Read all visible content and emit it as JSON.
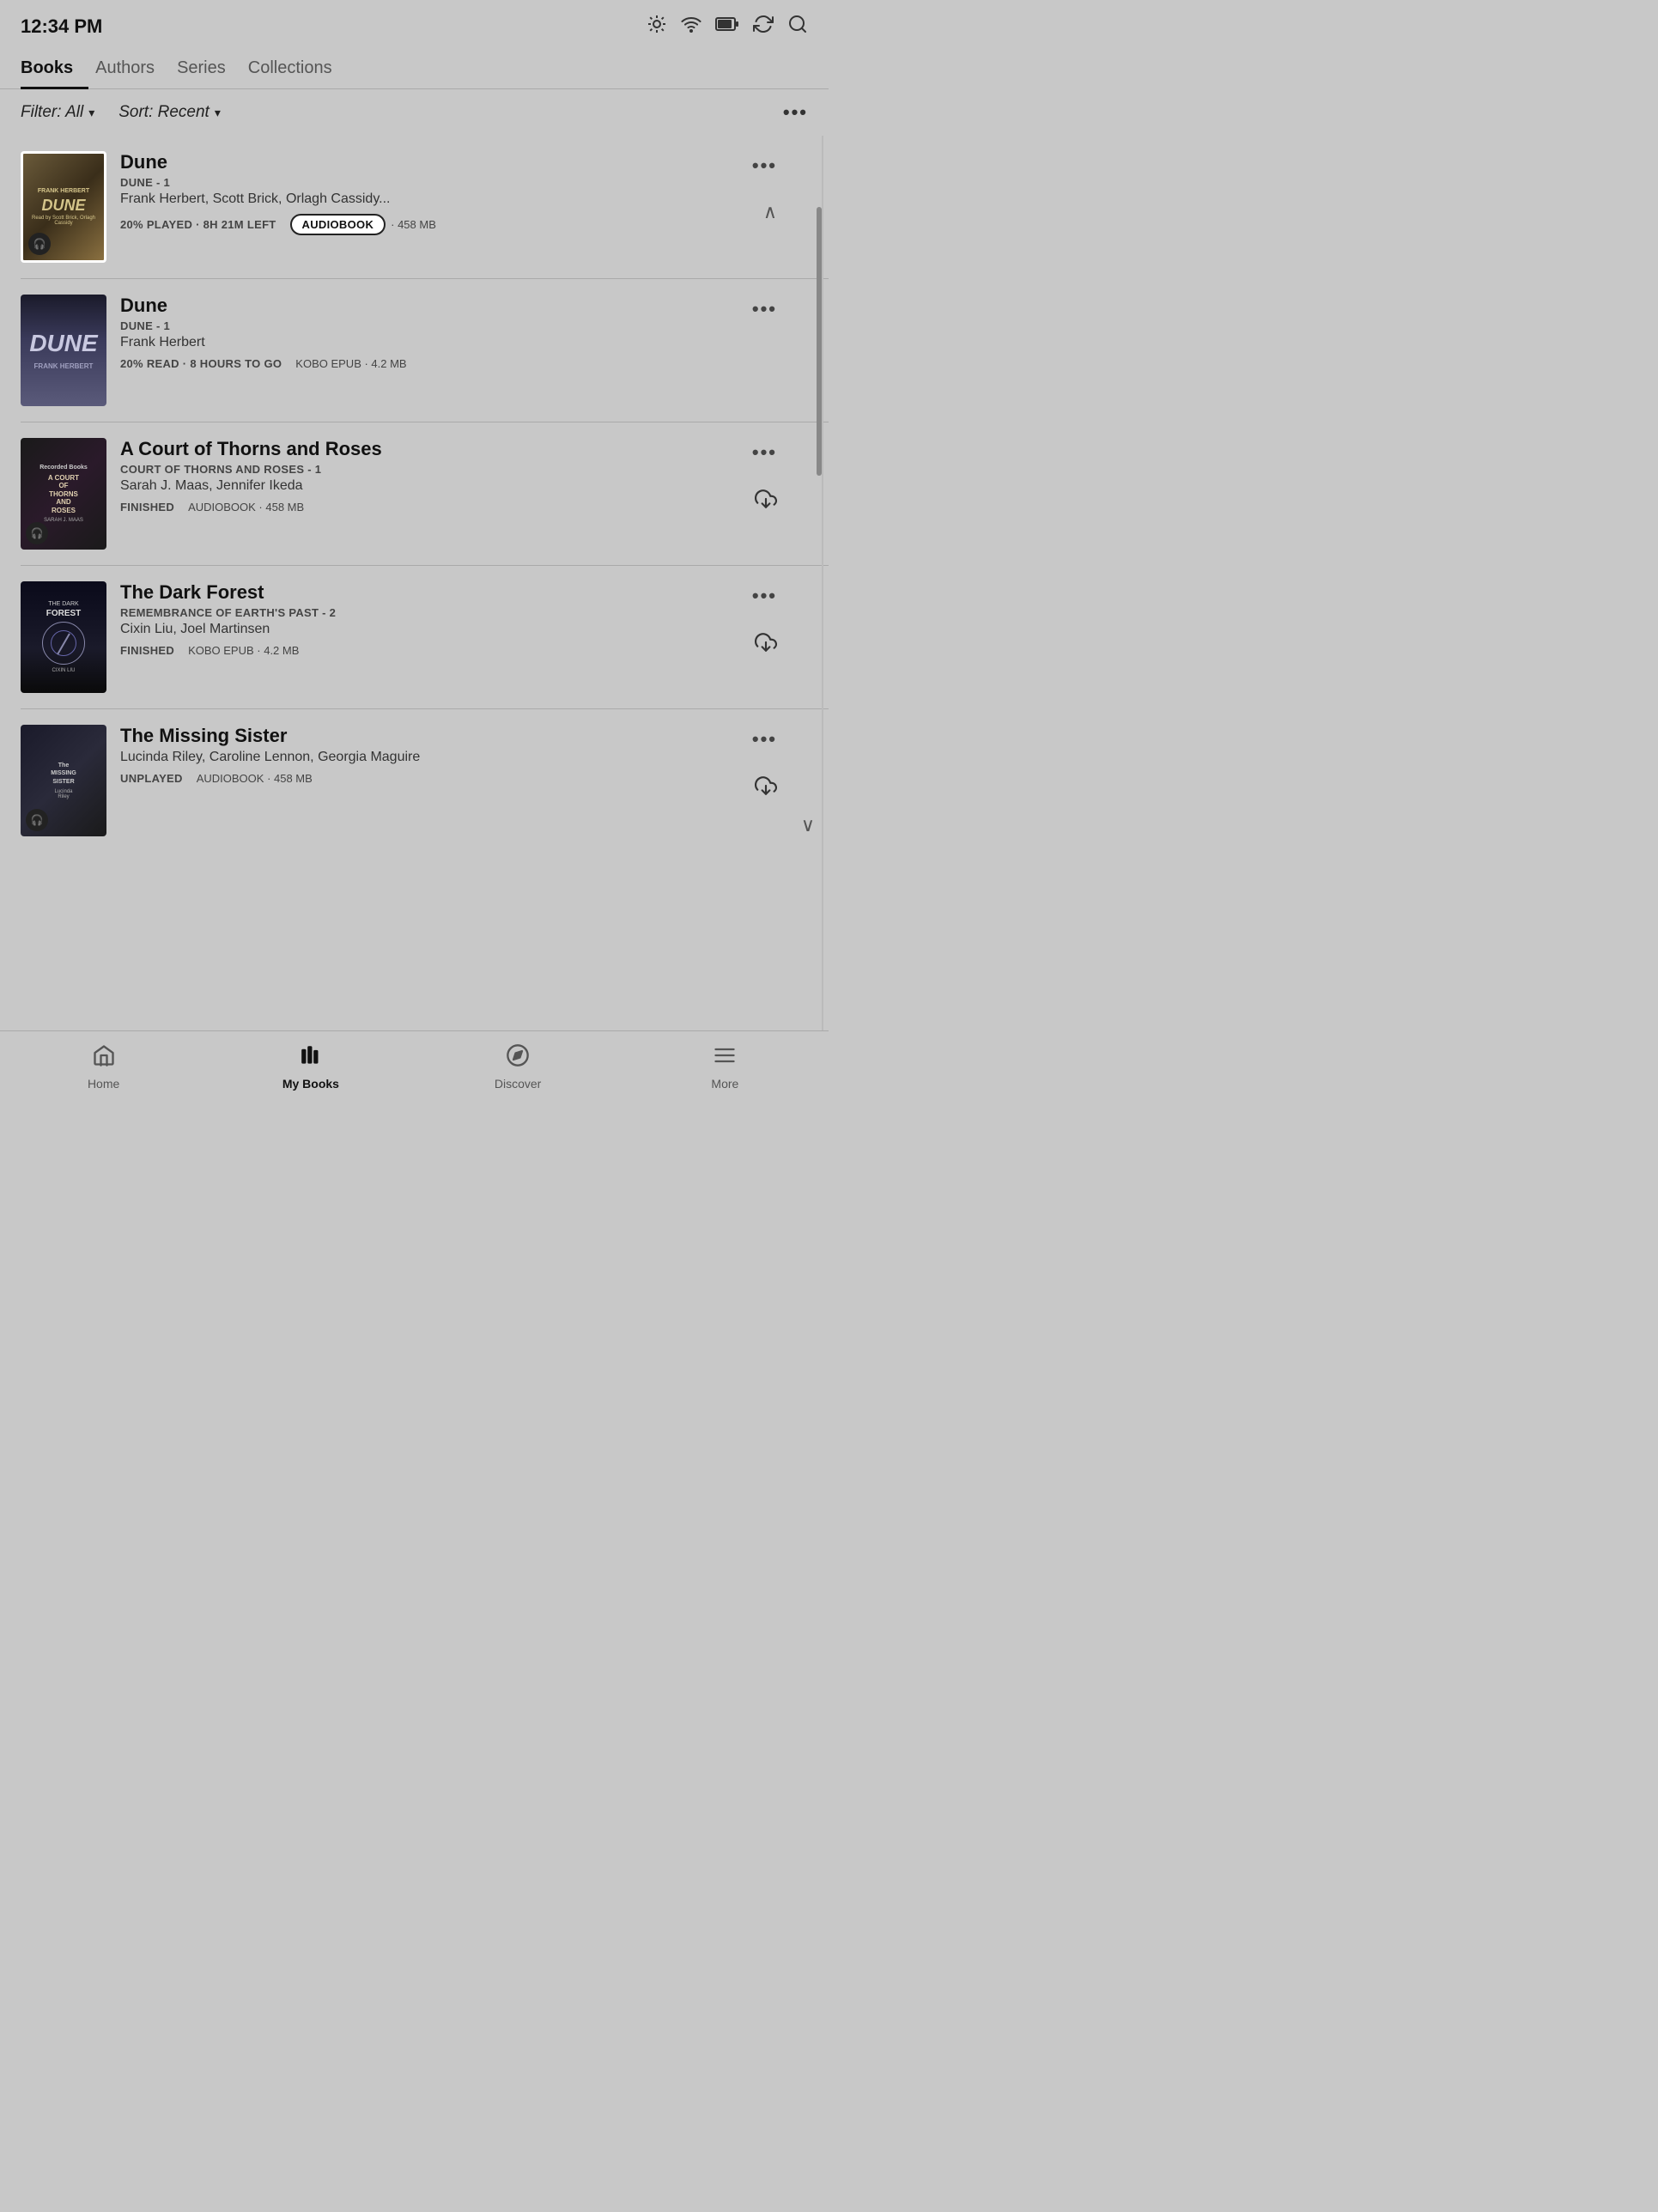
{
  "statusBar": {
    "time": "12:34 PM"
  },
  "tabs": [
    {
      "label": "Books",
      "active": true
    },
    {
      "label": "Authors",
      "active": false
    },
    {
      "label": "Series",
      "active": false
    },
    {
      "label": "Collections",
      "active": false
    }
  ],
  "filterBar": {
    "filter": "Filter: All",
    "sort": "Sort: Recent",
    "moreLabel": "•••"
  },
  "books": [
    {
      "title": "Dune",
      "series": "DUNE - 1",
      "authors": "Frank Herbert, Scott Brick, Orlagh Cassidy...",
      "status": "20% PLAYED · 8H 21M LEFT",
      "formatBadge": "AUDIOBOOK",
      "size": "458 MB",
      "coverStyle": "dune-audio",
      "hasAudioBadge": true,
      "hasBadgeHighlight": true,
      "showExpand": true,
      "expandDirection": "up"
    },
    {
      "title": "Dune",
      "series": "DUNE - 1",
      "authors": "Frank Herbert",
      "status": "20% READ · 8 HOURS TO GO",
      "format": "KOBO EPUB",
      "size": "4.2 MB",
      "coverStyle": "dune-epub",
      "hasAudioBadge": false,
      "showDownload": false
    },
    {
      "title": "A Court of Thorns and Roses",
      "series": "COURT OF THORNS AND ROSES - 1",
      "authors": "Sarah J. Maas, Jennifer Ikeda",
      "status": "FINISHED",
      "format": "AUDIOBOOK",
      "size": "458 MB",
      "coverStyle": "acotar",
      "hasAudioBadge": true,
      "showDownload": true
    },
    {
      "title": "The Dark Forest",
      "series": "REMEMBRANCE OF EARTH'S PAST - 2",
      "authors": "Cixin Liu, Joel Martinsen",
      "status": "FINISHED",
      "format": "KOBO EPUB",
      "size": "4.2 MB",
      "coverStyle": "dark-forest",
      "hasAudioBadge": false,
      "showDownload": true
    },
    {
      "title": "The Missing Sister",
      "series": "",
      "authors": "Lucinda Riley, Caroline Lennon, Georgia Maguire",
      "status": "UNPLAYED",
      "format": "AUDIOBOOK",
      "size": "458 MB",
      "coverStyle": "missing-sister",
      "hasAudioBadge": true,
      "showDownload": true,
      "showExpandDown": true
    }
  ],
  "bottomNav": [
    {
      "label": "Home",
      "icon": "home",
      "active": false
    },
    {
      "label": "My Books",
      "icon": "books",
      "active": true
    },
    {
      "label": "Discover",
      "icon": "compass",
      "active": false
    },
    {
      "label": "More",
      "icon": "menu",
      "active": false
    }
  ]
}
